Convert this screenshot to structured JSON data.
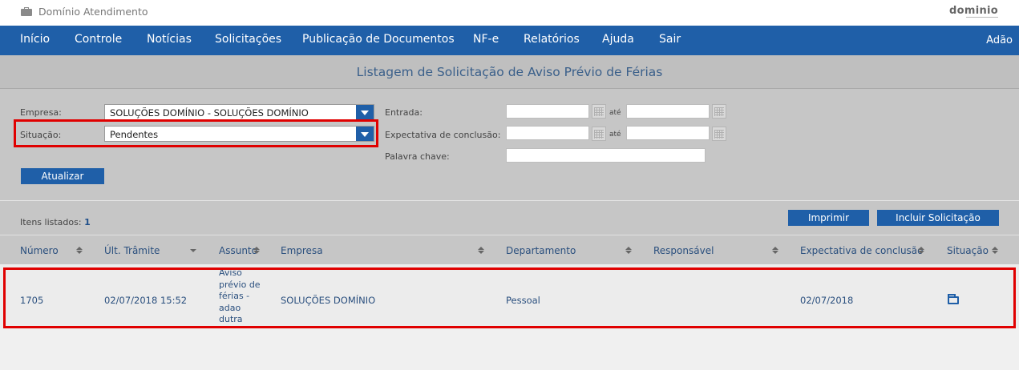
{
  "app": {
    "title": "Domínio Atendimento",
    "brand": "dominio"
  },
  "nav": {
    "items": [
      "Início",
      "Controle",
      "Notícias",
      "Solicitações",
      "Publicação de Documentos",
      "NF-e",
      "Relatórios",
      "Ajuda",
      "Sair"
    ],
    "user": "Adão"
  },
  "page": {
    "title": "Listagem de Solicitação de Aviso Prévio de Férias"
  },
  "filters": {
    "empresa_label": "Empresa:",
    "empresa_value": "SOLUÇÕES DOMÍNIO - SOLUÇÕES DOMÍNIO",
    "situacao_label": "Situação:",
    "situacao_value": "Pendentes",
    "entrada_label": "Entrada:",
    "expectativa_label": "Expectativa de conclusão:",
    "palavra_label": "Palavra chave:",
    "ate": "até",
    "atualizar": "Atualizar"
  },
  "toolbar": {
    "itens_label": "Itens listados:",
    "itens_count": "1",
    "imprimir": "Imprimir",
    "incluir": "Incluir Solicitação"
  },
  "table": {
    "headers": [
      "Número",
      "Últ. Trâmite",
      "Assunto",
      "Empresa",
      "Departamento",
      "Responsável",
      "Expectativa de conclusão",
      "Situação"
    ],
    "rows": [
      {
        "numero": "1705",
        "ult_tramite": "02/07/2018 15:52",
        "assunto": "Aviso prévio de férias - adao dutra",
        "empresa": "SOLUÇÕES DOMÍNIO",
        "departamento": "Pessoal",
        "responsavel": "",
        "expectativa": "02/07/2018",
        "situacao_icon": "folder-icon"
      }
    ]
  },
  "colors": {
    "primary": "#1f5fa8",
    "highlight": "#e00000"
  }
}
